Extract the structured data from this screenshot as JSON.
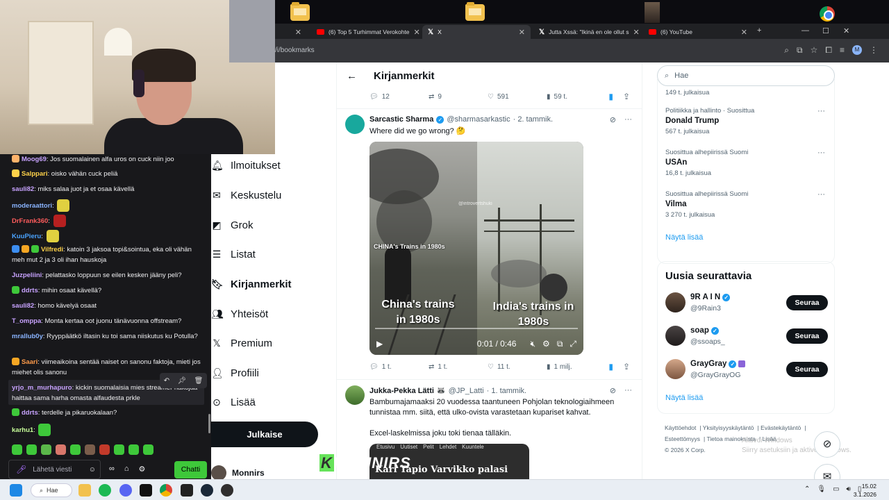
{
  "browser": {
    "tabs": [
      {
        "label": "(6) Top 5 Turhimmat Verokohte",
        "icon": "youtube-icon"
      },
      {
        "label": "X",
        "icon": "x-icon"
      },
      {
        "label": "Jutta Xssä: \"Ikinä en ole ollut s",
        "icon": "x-icon"
      },
      {
        "label": "(6) YouTube",
        "icon": "youtube-icon"
      }
    ],
    "url": "/i/bookmarks",
    "profile_initial": "M"
  },
  "nav": {
    "items": [
      {
        "label": "Ilmoitukset",
        "icon": "bell-icon"
      },
      {
        "label": "Keskustelu",
        "icon": "mail-icon"
      },
      {
        "label": "Grok",
        "icon": "grok-icon"
      },
      {
        "label": "Listat",
        "icon": "list-icon"
      },
      {
        "label": "Kirjanmerkit",
        "icon": "bookmark-icon"
      },
      {
        "label": "Yhteisöt",
        "icon": "communities-icon"
      },
      {
        "label": "Premium",
        "icon": "x-premium-icon"
      },
      {
        "label": "Profiili",
        "icon": "profile-icon"
      },
      {
        "label": "Lisää",
        "icon": "more-icon"
      }
    ],
    "post_label": "Julkaise",
    "profile_name": "Monnirs"
  },
  "main": {
    "title": "Kirjanmerkit",
    "prev_actions": {
      "replies": "12",
      "reposts": "9",
      "likes": "591",
      "views": "59 t."
    },
    "tweet1": {
      "name": "Sarcastic Sharma",
      "handle": "@sharmasarkastic",
      "date": "· 2. tammik.",
      "text": "Where did we go wrong? 🤔",
      "video": {
        "left_tag": "CHINA's Trains in 1980s",
        "watermark": "@introvertshuki",
        "left_caption": "China's trains in 1980s",
        "right_caption": "India's trains in 1980s",
        "time": "0:01 / 0:46"
      },
      "actions": {
        "replies": "1 t.",
        "reposts": "1 t.",
        "likes": "11 t.",
        "views": "1 milj."
      }
    },
    "tweet2": {
      "name": "Jukka-Pekka Lätti 🦝",
      "handle": "@JP_Latti",
      "date": "· 1. tammik.",
      "text1": "Bambumajamaaksi 20 vuodessa taantuneen Pohjolan teknologiaihmeen tunnistaa mm. siitä, että ulko-ovista varastetaan kupariset kahvat.",
      "text2": "Excel-laskelmissa joku toki tienaa tälläkin.",
      "preview_nav": [
        "Etusivu",
        "Uutiset",
        "Pelit",
        "Lehdet",
        "Kuuntele"
      ],
      "preview_headline": "Kari Tapio Varvikko palasi"
    }
  },
  "right": {
    "search_placeholder": "Hae",
    "trend_top_count": "149 t. julkaisua",
    "trends": [
      {
        "context": "Politiikka ja hallinto · Suosittua",
        "topic": "Donald Trump",
        "count": "567 t. julkaisua"
      },
      {
        "context": "Suosittua alhepiirissä Suomi",
        "topic": "USAn",
        "count": "16,8 t. julkaisua"
      },
      {
        "context": "Suosittua alhepiirissä Suomi",
        "topic": "Vilma",
        "count": "3 270 t. julkaisua"
      }
    ],
    "show_more": "Näytä lisää",
    "who_to_follow_title": "Uusia seurattavia",
    "follows": [
      {
        "name": "9R A I N",
        "handle": "@9Rain3",
        "button": "Seuraa"
      },
      {
        "name": "soap",
        "handle": "@ssoaps_",
        "button": "Seuraa"
      },
      {
        "name": "GrayGray",
        "handle": "@GrayGrayOG",
        "button": "Seuraa"
      }
    ],
    "show_more2": "Näytä lisää",
    "footer": [
      "Käyttöehdot",
      "Yksityisyyskäytäntö",
      "Evästekäytäntö",
      "Esteettömyys",
      "Tietoa mainoksista",
      "Lisää ···",
      "© 2026 X Corp."
    ],
    "activate_line1": "Aktivoi Windows",
    "activate_line2": "Siirry asetuksiin ja aktivoi Windows."
  },
  "chat": {
    "messages": [
      {
        "user": "Moog69",
        "color": "#c8a3ff",
        "text": "Jos suomalainen alfa uros on cuck niin joo"
      },
      {
        "user": "Salppari",
        "color": "#ffd24a",
        "text": "oisko vähän cuck peliä"
      },
      {
        "user": "sauli82",
        "color": "#c8a3ff",
        "text": "miks salaa juot ja et osaa kävellä"
      },
      {
        "user": "moderaattori",
        "color": "#8ab4ff",
        "text": ""
      },
      {
        "user": "DrFrank360",
        "color": "#ff5c5c",
        "text": ""
      },
      {
        "user": "KuuPieru",
        "color": "#4aa3ff",
        "text": ""
      },
      {
        "user": "Vilfredi",
        "color": "#ffd24a",
        "text": "katoin 3 jaksoa topi&sointua, eka oli vähän meh mut 2 ja 3 oli ihan hauskoja"
      },
      {
        "user": "Juzpeliini",
        "color": "#c8a3ff",
        "text": "pelattasko loppuun se eilen kesken jääny peli?"
      },
      {
        "user": "ddrts",
        "color": "#c8a3ff",
        "text": "mihin osaat kävellä?"
      },
      {
        "user": "sauli82",
        "color": "#c8a3ff",
        "text": "homo kävelyä osaat"
      },
      {
        "user": "T_omppa",
        "color": "#c8a3ff",
        "text": "Monta kertaa oot juonu tänävuonna offstream?"
      },
      {
        "user": "mrallub0y",
        "color": "#8ab4ff",
        "text": "Ryyppäätkö iltasin ku toi sama niiskutus ku Potulla?"
      },
      {
        "user": "Saari",
        "color": "#ff9b4a",
        "text": "viimeaikoina sentää naiset on sanonu faktoja, mieti jos miehet olis sanonu"
      },
      {
        "user": "yrjo_m_murhapuro",
        "color": "#c8a3ff",
        "text": "kickin suomalaisia mies streamer näköjää haittaa sama harha omasta alfaudesta prkle"
      },
      {
        "user": "ddrts",
        "color": "#c8a3ff",
        "text": "terdelle ja pikaruokalaan?"
      },
      {
        "user": "karhu1",
        "color": "#c8ff9a",
        "text": ""
      }
    ],
    "input_placeholder": "Lähetä viesti",
    "send_label": "Chatti"
  },
  "overlay_logo": "MONNIRS",
  "taskbar": {
    "search_label": "Hae",
    "time": "15.02",
    "date": "3.1.2026"
  },
  "colors": {
    "x_blue": "#1d9bf0",
    "twitch_green": "#3ec83a",
    "chat_bg": "#18181b"
  }
}
